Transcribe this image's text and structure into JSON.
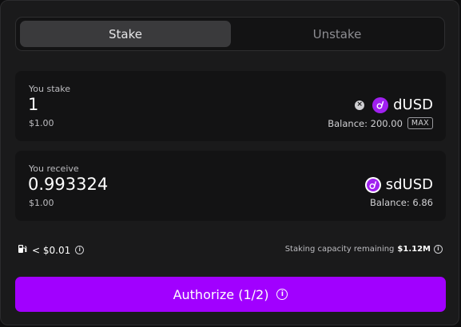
{
  "tabs": {
    "stake": "Stake",
    "unstake": "Unstake"
  },
  "stake_card": {
    "label": "You stake",
    "amount": "1",
    "usd": "$1.00",
    "token": "dUSD",
    "balance": "Balance: 200.00",
    "max": "MAX",
    "clear_icon": "close-circle-icon"
  },
  "receive_card": {
    "label": "You receive",
    "amount": "0.993324",
    "usd": "$1.00",
    "token": "sdUSD",
    "balance": "Balance: 6.86"
  },
  "fee": {
    "icon": "gas-pump-icon",
    "value": "< $0.01"
  },
  "capacity": {
    "label": "Staking capacity remaining",
    "value": "$1.12M"
  },
  "authorize_button": "Authorize (1/2)",
  "colors": {
    "accent": "#a100ff",
    "token": "#a020f0",
    "background": "#1a1a1b"
  }
}
